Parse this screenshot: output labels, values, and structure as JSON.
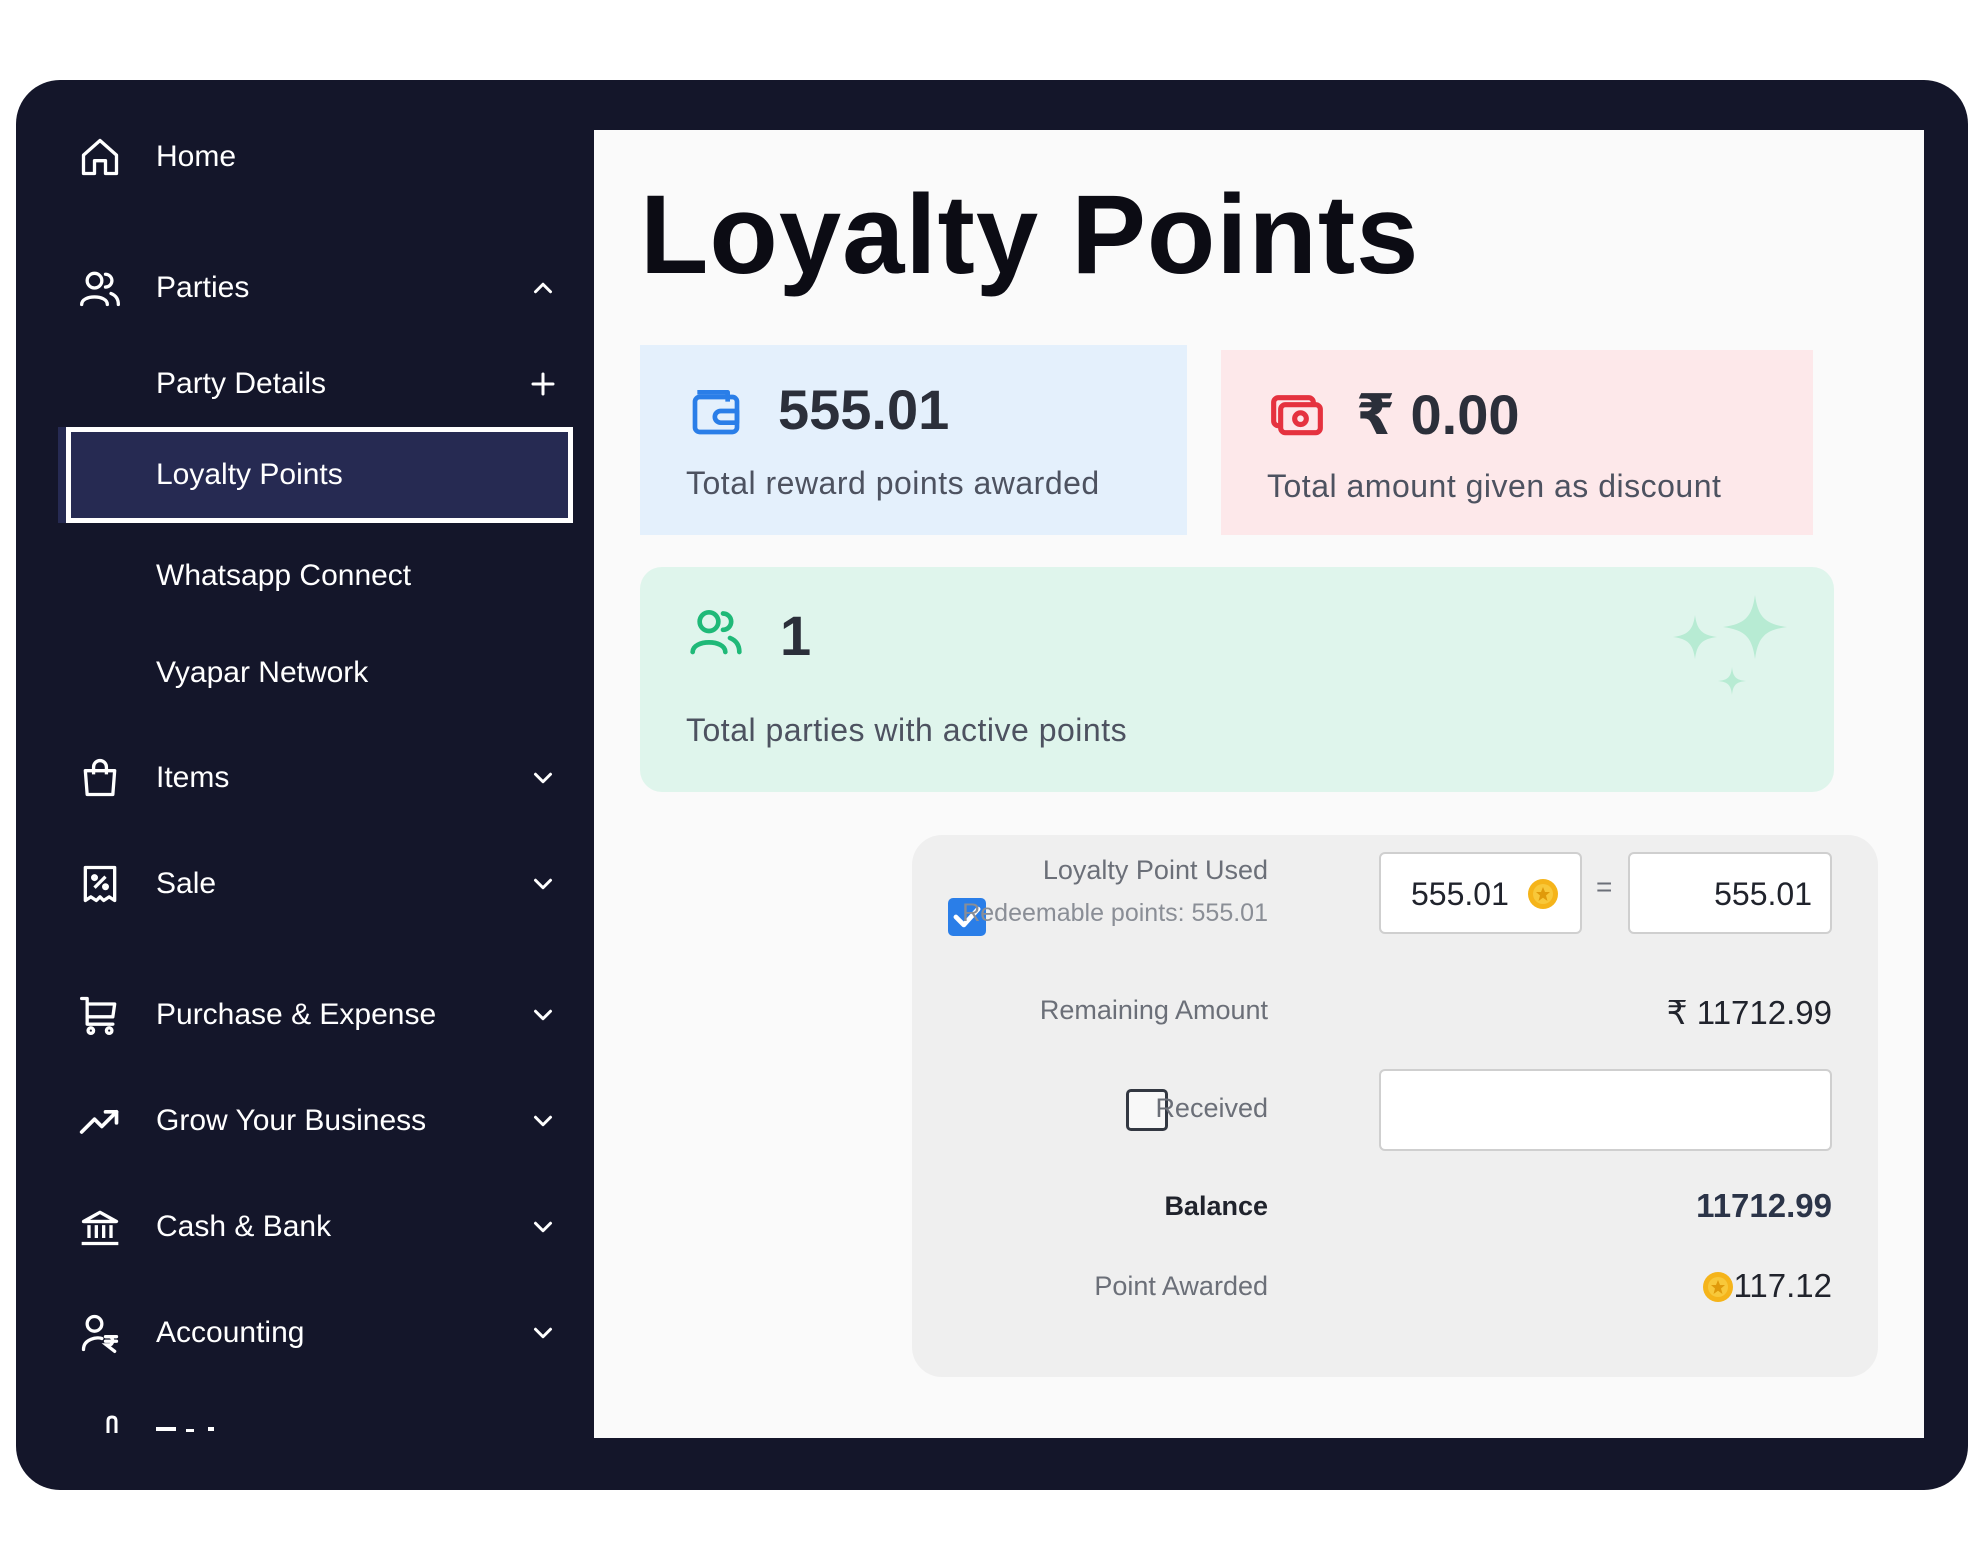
{
  "sidebar": {
    "home": "Home",
    "parties": "Parties",
    "party_details": "Party Details",
    "loyalty_points": "Loyalty Points",
    "whatsapp_connect": "Whatsapp Connect",
    "vyapar_network": "Vyapar Network",
    "items": "Items",
    "sale": "Sale",
    "purchase_expense": "Purchase & Expense",
    "grow_business": "Grow Your Business",
    "cash_bank": "Cash & Bank",
    "accounting": "Accounting"
  },
  "page": {
    "title": "Loyalty Points"
  },
  "stats": {
    "reward": {
      "value": "555.01",
      "label": "Total reward points awarded"
    },
    "discount": {
      "value": "₹ 0.00",
      "label": "Total amount given as discount"
    },
    "parties": {
      "value": "1",
      "label": "Total parties with active points"
    }
  },
  "form": {
    "loyalty_used_label": "Loyalty Point Used",
    "redeemable_label": "Redeemable points: 555.01",
    "points_input": "555.01",
    "equals": "=",
    "amount_input": "555.01",
    "remaining_label": "Remaining Amount",
    "remaining_value": "₹ 11712.99",
    "received_label": "Received",
    "received_value": "",
    "balance_label": "Balance",
    "balance_value": "11712.99",
    "awarded_label": "Point Awarded",
    "awarded_value": "117.12",
    "loyalty_checked": true,
    "received_checked": false
  },
  "colors": {
    "sidebar_bg": "#14162a",
    "active_item_bg": "#262a52",
    "blue_accent": "#2a7ee8",
    "red_accent": "#e5323f",
    "green_accent": "#1fb978",
    "coin": "#f5b41a"
  },
  "icons": [
    "home-icon",
    "users-icon",
    "plus-icon",
    "shopping-bag-icon",
    "receipt-icon",
    "cart-icon",
    "trending-up-icon",
    "bank-icon",
    "user-rupee-icon",
    "chevron-up-icon",
    "chevron-down-icon",
    "wallet-icon",
    "cash-icon",
    "sparkles-icon",
    "coin-icon",
    "checkmark-icon"
  ]
}
